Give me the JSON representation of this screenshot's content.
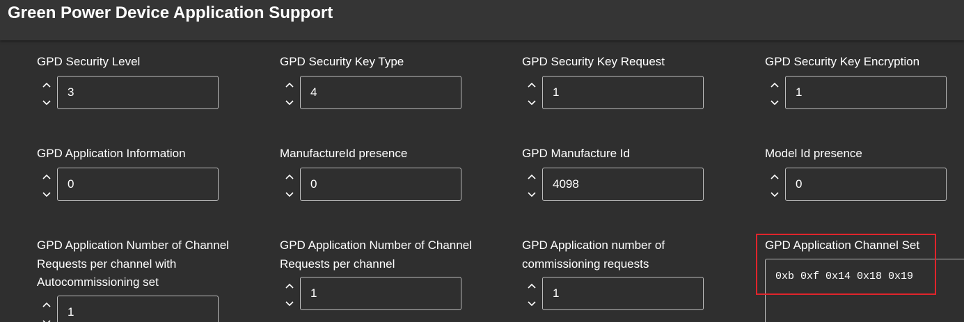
{
  "header": {
    "title": "Green Power Device Application Support"
  },
  "fields": {
    "security_level": {
      "label": "GPD Security Level",
      "value": "3"
    },
    "security_key_type": {
      "label": "GPD Security Key Type",
      "value": "4"
    },
    "security_key_request": {
      "label": "GPD Security Key Request",
      "value": "1"
    },
    "security_key_encryption": {
      "label": "GPD Security Key Encryption",
      "value": "1"
    },
    "application_information": {
      "label": "GPD Application Information",
      "value": "0"
    },
    "manufacturer_id_presence": {
      "label": "ManufactureId presence",
      "value": "0"
    },
    "manufacture_id": {
      "label": "GPD Manufacture Id",
      "value": "4098"
    },
    "model_id_presence": {
      "label": "Model Id presence",
      "value": "0"
    },
    "channel_requests_autocommissioning": {
      "label": "GPD Application Number of Channel Requests per channel with Autocommissioning set",
      "value": "1"
    },
    "channel_requests_per_channel": {
      "label": "GPD Application Number of Channel Requests per channel",
      "value": "1"
    },
    "commissioning_requests": {
      "label": "GPD Application number of commissioning requests",
      "value": "1"
    },
    "channel_set": {
      "label": "GPD Application Channel Set",
      "value": "0xb 0xf 0x14 0x18 0x19"
    }
  },
  "colors": {
    "background": "#2f2f2f",
    "header_background": "#353535",
    "input_border": "#bdbdbd",
    "highlight": "#e0242b",
    "text": "#ffffff"
  },
  "icons": {
    "spin_up": "chevron-up-icon",
    "spin_down": "chevron-down-icon"
  }
}
